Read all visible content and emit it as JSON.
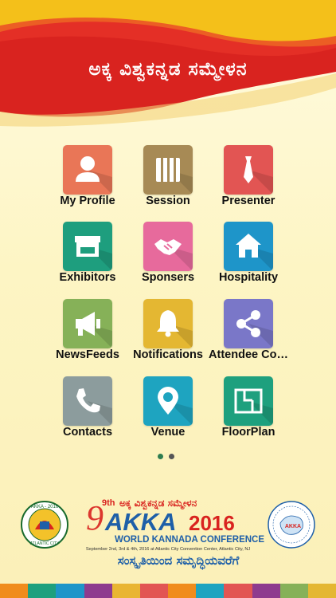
{
  "header": {
    "title": "ಅಕ್ಕ ವಿಶ್ವಕನ್ನಡ ಸಮ್ಮೇಳನ"
  },
  "tiles": [
    {
      "label": "My Profile",
      "color": "#e97657",
      "icon": "person-icon"
    },
    {
      "label": "Session",
      "color": "#a78a55",
      "icon": "columns-icon"
    },
    {
      "label": "Presenter",
      "color": "#e25553",
      "icon": "tie-icon"
    },
    {
      "label": "Exhibitors",
      "color": "#1e9e7e",
      "icon": "store-icon"
    },
    {
      "label": "Sponsers",
      "color": "#e76a9c",
      "icon": "handshake-icon"
    },
    {
      "label": "Hospitality",
      "color": "#1e95c9",
      "icon": "home-icon"
    },
    {
      "label": "NewsFeeds",
      "color": "#86b158",
      "icon": "megaphone-icon"
    },
    {
      "label": "Notifications",
      "color": "#e4b732",
      "icon": "bell-icon"
    },
    {
      "label": "Attendee Co…",
      "color": "#7a77c8",
      "icon": "share-icon"
    },
    {
      "label": "Contacts",
      "color": "#8c9c9d",
      "icon": "phone-icon"
    },
    {
      "label": "Venue",
      "color": "#1ea4c0",
      "icon": "location-icon"
    },
    {
      "label": "FloorPlan",
      "color": "#1ea07e",
      "icon": "floorplan-icon"
    }
  ],
  "pager": {
    "pages": 2,
    "active": 1,
    "active_color": "#2e7d4f",
    "inactive_color": "#555555"
  },
  "footer": {
    "edition": "9th",
    "akka_kannada": "ಅಕ್ಕ ವಿಶ್ವಕನ್ನಡ ಸಮ್ಮೇಳನ",
    "brand": "AKKA",
    "year": "2016",
    "subtitle": "WORLD KANNADA CONFERENCE",
    "dates": "September 2nd, 3rd & 4th, 2016 at Atlantic City Convention Center,  Atlantic City, NJ",
    "tagline": "ಸಂಸ್ಕೃತಿಯಿಂದ ಸಮೃದ್ಧಿಯವರೆಗೆ",
    "left_seal_top": "AKKA - 2016",
    "left_seal_bottom": "ATLANTIC CITY",
    "right_seal_text": "AKKA"
  },
  "strip_colors": [
    "#f08c1c",
    "#1ea07e",
    "#1e95c9",
    "#8e3b8e",
    "#e9b532",
    "#e25553",
    "#f08c1c",
    "#1ea4c0",
    "#e25553",
    "#8e3b8e",
    "#86b158",
    "#e4b732"
  ]
}
